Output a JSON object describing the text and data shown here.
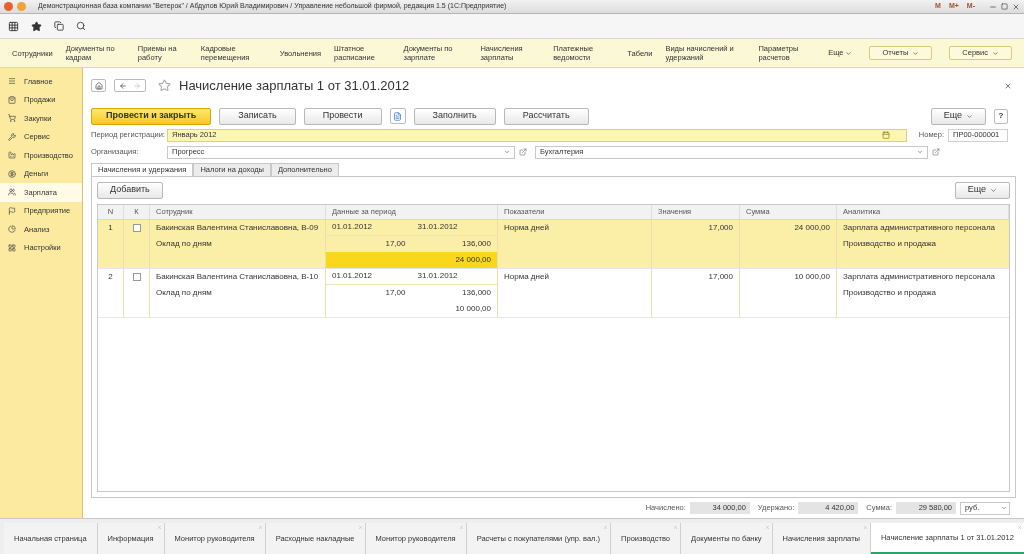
{
  "window": {
    "title": "Демонстрационная база компании \"Ветерок\" / Абдулов Юрий Владимирович / Управление небольшой фирмой, редакция 1.5  (1С:Предприятие)",
    "memory_buttons": [
      "M",
      "M+",
      "M-"
    ]
  },
  "section_menu": [
    {
      "label": "Сотрудники",
      "kind": "link"
    },
    {
      "label": "Документы по кадрам",
      "kind": "link"
    },
    {
      "label": "Приемы на работу",
      "kind": "link"
    },
    {
      "label": "Кадровые перемещения",
      "kind": "link"
    },
    {
      "label": "Увольнения",
      "kind": "link"
    },
    {
      "label": "Штатное расписание",
      "kind": "link"
    },
    {
      "label": "Документы по зарплате",
      "kind": "link"
    },
    {
      "label": "Начисления зарплаты",
      "kind": "link"
    },
    {
      "label": "Платежные ведомости",
      "kind": "link"
    },
    {
      "label": "Табели",
      "kind": "link"
    },
    {
      "label": "Виды начислений и удержаний",
      "kind": "link"
    },
    {
      "label": "Параметры расчетов",
      "kind": "link"
    },
    {
      "label": "Еще",
      "kind": "more"
    },
    {
      "label": "Отчеты",
      "kind": "dropdown"
    },
    {
      "label": "Сервис",
      "kind": "dropdown"
    }
  ],
  "sidebar": {
    "items": [
      {
        "label": "Главное",
        "selected": false
      },
      {
        "label": "Продажи",
        "selected": false
      },
      {
        "label": "Закупки",
        "selected": false
      },
      {
        "label": "Сервис",
        "selected": false
      },
      {
        "label": "Производство",
        "selected": false
      },
      {
        "label": "Деньги",
        "selected": false
      },
      {
        "label": "Зарплата",
        "selected": true
      },
      {
        "label": "Предприятие",
        "selected": false
      },
      {
        "label": "Анализ",
        "selected": false
      },
      {
        "label": "Настройки",
        "selected": false
      }
    ]
  },
  "form": {
    "title": "Начисление зарплаты 1 от 31.01.2012",
    "buttons": [
      {
        "label": "Провести и закрыть",
        "kind": "primary"
      },
      {
        "label": "Записать",
        "kind": "normal"
      },
      {
        "label": "Провести",
        "kind": "normal"
      },
      {
        "kind": "icon"
      },
      {
        "label": "Заполнить",
        "kind": "normal"
      },
      {
        "label": "Рассчитать",
        "kind": "normal"
      }
    ],
    "more_button": "Еще",
    "help_button": "?",
    "period": {
      "label": "Период регистрации:",
      "value": "Январь 2012"
    },
    "number": {
      "label": "Номер:",
      "value": "ПР00-000001"
    },
    "organization": {
      "label": "Организация:",
      "value": "Прогресс"
    },
    "department": {
      "value": "Бухгалтерия"
    },
    "tabs": [
      {
        "label": "Начисления и удержания",
        "selected": true
      },
      {
        "label": "Налоги на доходы",
        "selected": false
      },
      {
        "label": "Дополнительно",
        "selected": false
      }
    ],
    "add_button": "Добавить",
    "table_more_button": "Еще",
    "table": {
      "columns": [
        "N",
        "К",
        "Сотрудник",
        "Данные за период",
        "Показатели",
        "Значения",
        "Сумма",
        "Аналитика"
      ],
      "rows": [
        {
          "n": "1",
          "checked": false,
          "selected": true,
          "employee": "Бакинская Валентина Станиславовна, В-09",
          "accrual": "Оклад по дням",
          "date_from": "01.01.2012",
          "date_to": "31.01.2012",
          "days": "17,00",
          "hours": "136,000",
          "amount": "24 000,00",
          "indicator": "Норма дней",
          "indicator_value": "17,000",
          "sum": "24 000,00",
          "analytics": [
            "Зарплата административного персонала",
            "Производство и продажа"
          ]
        },
        {
          "n": "2",
          "checked": false,
          "selected": false,
          "employee": "Бакинская Валентина Станиславовна, В-10",
          "accrual": "Оклад по дням",
          "date_from": "01.01.2012",
          "date_to": "31.01.2012",
          "days": "17,00",
          "hours": "136,000",
          "amount": "10 000,00",
          "indicator": "Норма дней",
          "indicator_value": "17,000",
          "sum": "10 000,00",
          "analytics": [
            "Зарплата административного персонала",
            "Производство и продажа"
          ]
        }
      ]
    },
    "totals": [
      {
        "label": "Начислено:",
        "value": "34 000,00"
      },
      {
        "label": "Удержано:",
        "value": "4 420,00"
      },
      {
        "label": "Сумма:",
        "value": "29 580,00"
      }
    ],
    "currency": "руб."
  },
  "open_windows": [
    {
      "label": "Начальная страница",
      "selected": false,
      "closable": false
    },
    {
      "label": "Информация",
      "selected": false,
      "closable": true
    },
    {
      "label": "Монитор руководителя",
      "selected": false,
      "closable": true
    },
    {
      "label": "Расходные накладные",
      "selected": false,
      "closable": true
    },
    {
      "label": "Монитор руководителя",
      "selected": false,
      "closable": true
    },
    {
      "label": "Расчеты с покупателями (упр. вал.)",
      "selected": false,
      "closable": true
    },
    {
      "label": "Производство",
      "selected": false,
      "closable": true
    },
    {
      "label": "Документы по банку",
      "selected": false,
      "closable": true
    },
    {
      "label": "Начисления зарплаты",
      "selected": false,
      "closable": true
    },
    {
      "label": "Начисление зарплаты 1 от 31.01.2012",
      "selected": true,
      "closable": true
    }
  ]
}
